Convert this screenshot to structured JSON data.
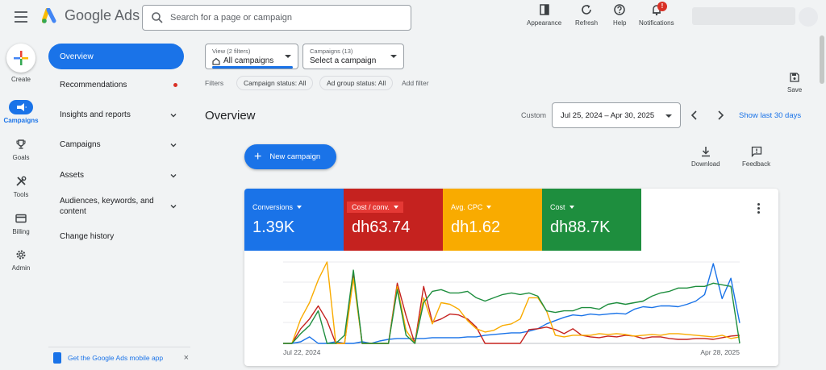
{
  "app": {
    "name": "Google Ads"
  },
  "search": {
    "placeholder": "Search for a page or campaign"
  },
  "top_actions": [
    {
      "label": "Appearance",
      "icon": "appearance-icon"
    },
    {
      "label": "Refresh",
      "icon": "refresh-icon"
    },
    {
      "label": "Help",
      "icon": "help-icon"
    },
    {
      "label": "Notifications",
      "icon": "bell-icon",
      "badge": "!"
    }
  ],
  "rail": {
    "create_label": "Create",
    "items": [
      {
        "label": "Campaigns",
        "icon": "megaphone-icon",
        "active": true
      },
      {
        "label": "Goals",
        "icon": "trophy-icon"
      },
      {
        "label": "Tools",
        "icon": "tools-icon"
      },
      {
        "label": "Billing",
        "icon": "card-icon"
      },
      {
        "label": "Admin",
        "icon": "gear-icon"
      }
    ]
  },
  "sidenav": {
    "items": [
      {
        "label": "Overview",
        "active": true
      },
      {
        "label": "Recommendations",
        "dot": true
      },
      {
        "label": "Insights and reports",
        "expandable": true
      },
      {
        "label": "Campaigns",
        "expandable": true
      },
      {
        "label": "Assets",
        "expandable": true
      },
      {
        "label": "Audiences, keywords, and content",
        "expandable": true
      },
      {
        "label": "Change history"
      }
    ],
    "promo": "Get the Google Ads mobile app",
    "promo_close": "×"
  },
  "view_dropdown": {
    "label": "View (2 filters)",
    "value": "All campaigns"
  },
  "campaigns_dropdown": {
    "label": "Campaigns (13)",
    "value": "Select a campaign"
  },
  "filters": {
    "label": "Filters",
    "chips": [
      "Campaign status: All",
      "Ad group status: All"
    ],
    "add": "Add filter"
  },
  "save_label": "Save",
  "page_title": "Overview",
  "date": {
    "custom_label": "Custom",
    "range": "Jul 25, 2024 – Apr 30, 2025",
    "show_last": "Show last 30 days"
  },
  "new_campaign": {
    "plus": "+",
    "label": "New campaign"
  },
  "download_label": "Download",
  "feedback_label": "Feedback",
  "metrics": [
    {
      "name": "Conversions",
      "value": "1.39K",
      "color": "#1a73e8"
    },
    {
      "name": "Cost / conv.",
      "value": "dh63.74",
      "color": "#c5221f"
    },
    {
      "name": "Avg. CPC",
      "value": "dh1.62",
      "color": "#f9ab00"
    },
    {
      "name": "Cost",
      "value": "dh88.7K",
      "color": "#1e8e3e"
    }
  ],
  "chart_data": {
    "type": "line",
    "x_start_label": "Jul 22, 2024",
    "x_end_label": "Apr 28, 2025",
    "grid": true,
    "series": [
      {
        "name": "Conversions",
        "color": "#1a73e8",
        "values": [
          0,
          0,
          2,
          8,
          0,
          0,
          2,
          0,
          0,
          2,
          0,
          3,
          5,
          6,
          6,
          6,
          6,
          7,
          7,
          7,
          7,
          8,
          8,
          10,
          11,
          12,
          13,
          13,
          15,
          18,
          24,
          28,
          32,
          35,
          34,
          36,
          35,
          36,
          37,
          36,
          42,
          45,
          44,
          46,
          46,
          45,
          48,
          52,
          60,
          98,
          55,
          80,
          25
        ]
      },
      {
        "name": "Cost / conv.",
        "color": "#c5221f",
        "values": [
          0,
          0,
          18,
          30,
          46,
          28,
          0,
          0,
          85,
          0,
          0,
          0,
          0,
          74,
          34,
          0,
          70,
          26,
          30,
          36,
          35,
          30,
          20,
          0,
          0,
          0,
          0,
          0,
          17,
          18,
          20,
          17,
          12,
          18,
          10,
          8,
          7,
          9,
          8,
          10,
          9,
          6,
          8,
          8,
          6,
          5,
          5,
          6,
          6,
          5,
          7,
          9,
          10
        ]
      },
      {
        "name": "Avg. CPC",
        "color": "#f9ab00",
        "values": [
          0,
          0,
          30,
          50,
          78,
          100,
          0,
          0,
          80,
          0,
          0,
          0,
          0,
          70,
          16,
          0,
          56,
          24,
          50,
          48,
          42,
          28,
          18,
          14,
          16,
          22,
          24,
          30,
          56,
          56,
          40,
          10,
          8,
          10,
          10,
          10,
          12,
          11,
          12,
          11,
          9,
          10,
          11,
          10,
          12,
          12,
          11,
          10,
          9,
          8,
          10,
          6,
          8
        ]
      },
      {
        "name": "Cost",
        "color": "#1e8e3e",
        "values": [
          0,
          0,
          12,
          22,
          40,
          0,
          0,
          10,
          90,
          0,
          0,
          0,
          0,
          66,
          10,
          0,
          50,
          64,
          66,
          62,
          62,
          64,
          56,
          52,
          56,
          60,
          62,
          60,
          62,
          58,
          40,
          38,
          40,
          40,
          44,
          44,
          42,
          48,
          50,
          48,
          50,
          52,
          58,
          62,
          64,
          68,
          68,
          70,
          70,
          74,
          72,
          70,
          0
        ]
      }
    ]
  },
  "colors": {
    "accent": "#1a73e8",
    "badge": "#d93025"
  }
}
